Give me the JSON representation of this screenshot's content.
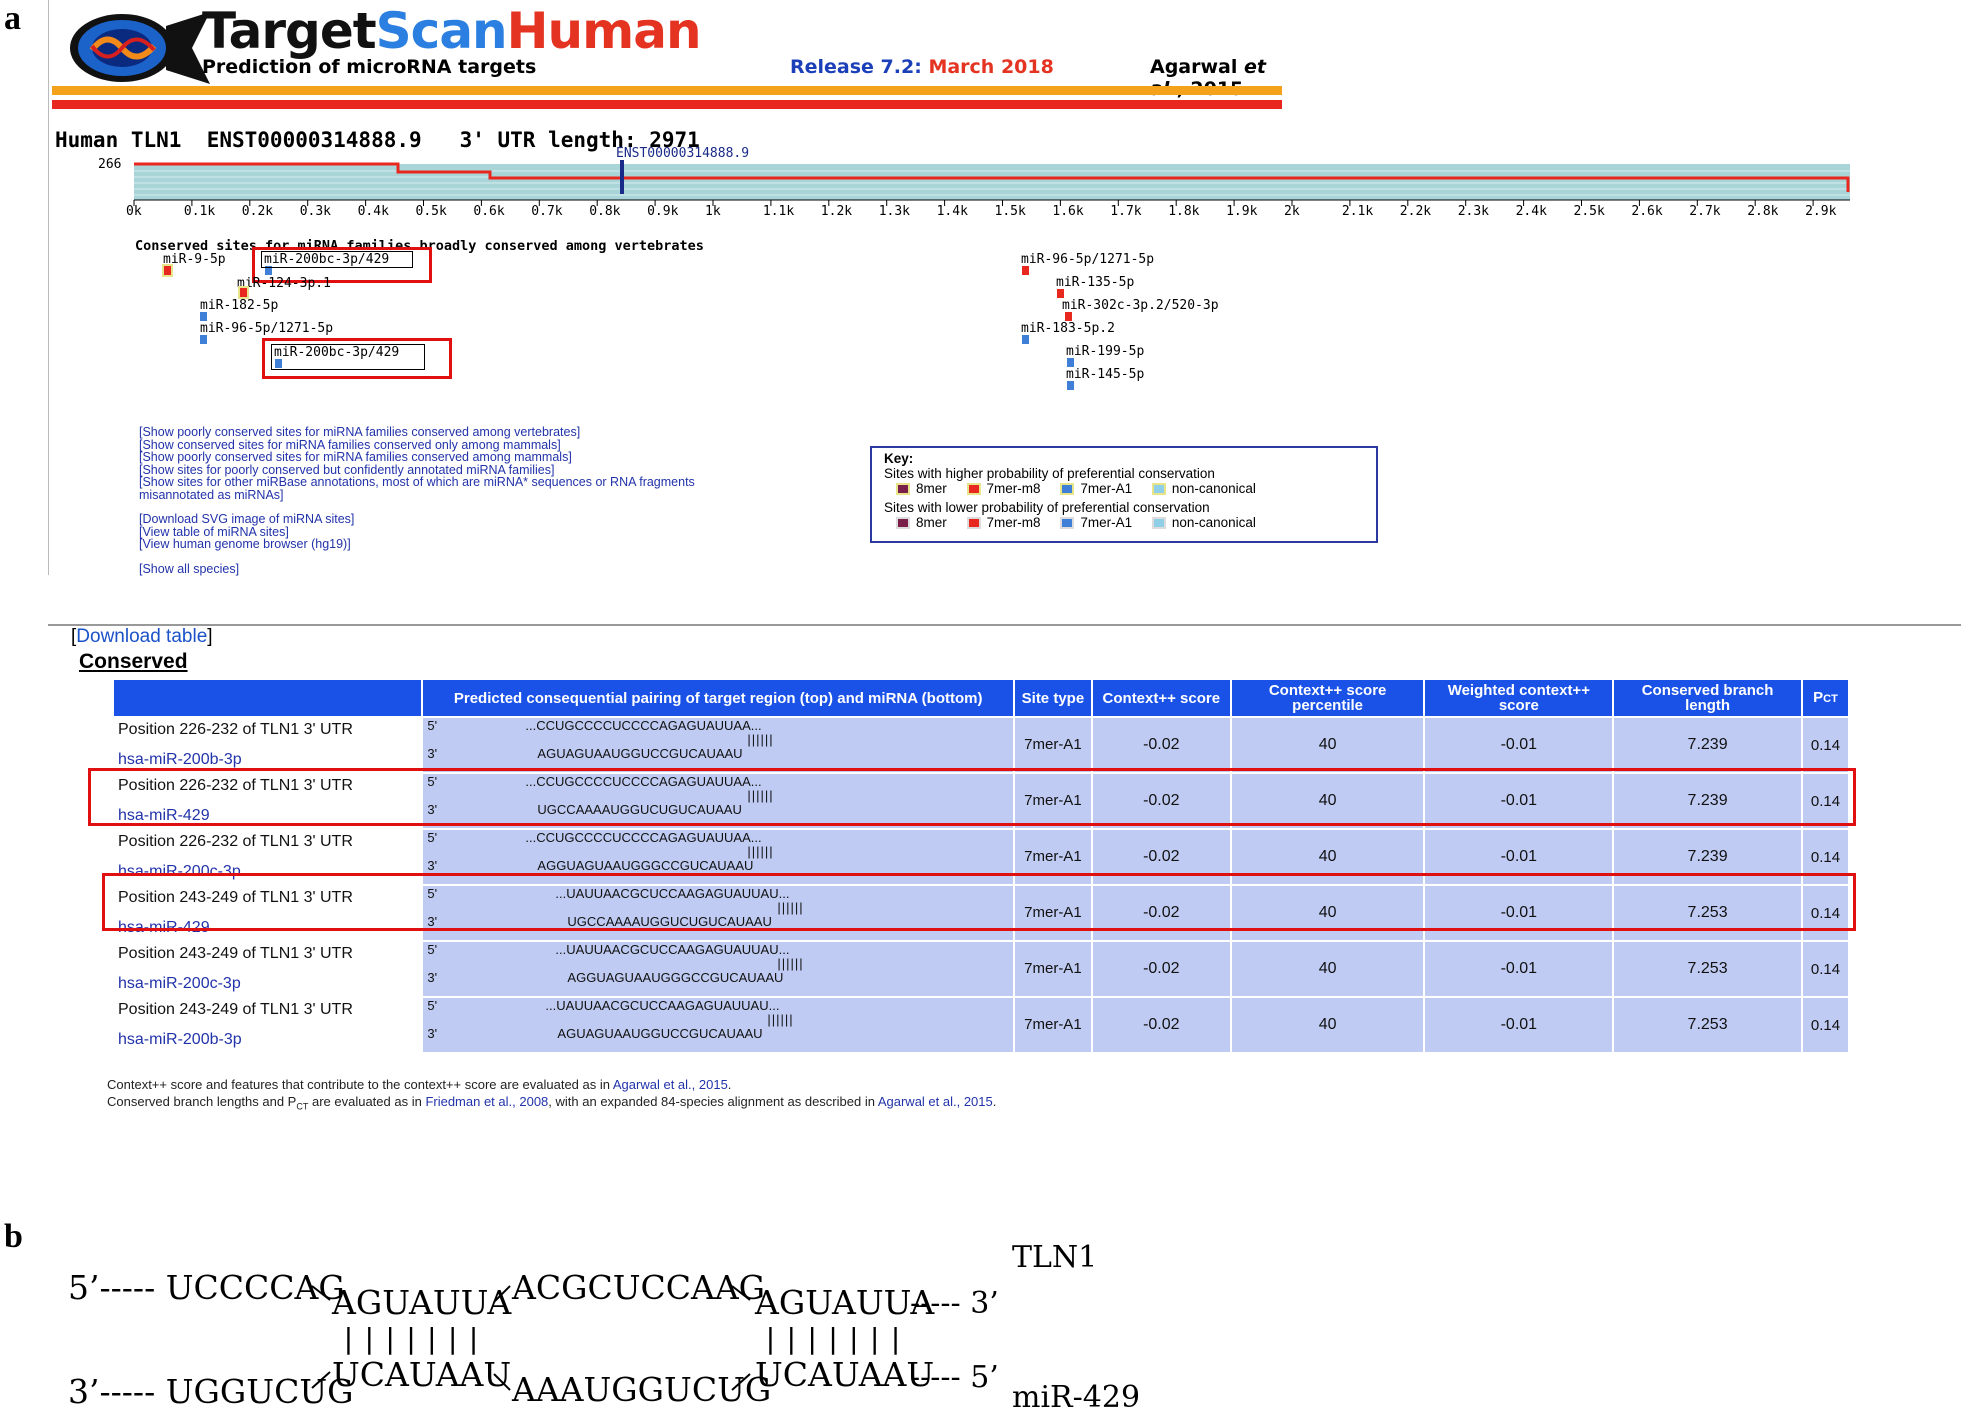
{
  "panel_a_label": "a",
  "panel_b_label": "b",
  "header": {
    "logo_target": "Target",
    "logo_scan": "Scan",
    "logo_human": "Human",
    "tagline": "Prediction of microRNA targets",
    "release_label": "Release 7.2:",
    "release_date": "March 2018",
    "citation_author": "Agarwal",
    "citation_etal": "et al.",
    "citation_year": ", 2015"
  },
  "gene_title": "Human TLN1  ENST00000314888.9   3' UTR length: 2971",
  "utr_track": {
    "y_label": "266",
    "marker_label": "ENST00000314888.9",
    "ticks": [
      "0k",
      "0.1k",
      "0.2k",
      "0.3k",
      "0.4k",
      "0.5k",
      "0.6k",
      "0.7k",
      "0.8k",
      "0.9k",
      "1k",
      "1.1k",
      "1.2k",
      "1.3k",
      "1.4k",
      "1.5k",
      "1.6k",
      "1.7k",
      "1.8k",
      "1.9k",
      "2k",
      "2.1k",
      "2.2k",
      "2.3k",
      "2.4k",
      "2.5k",
      "2.6k",
      "2.7k",
      "2.8k",
      "2.9k"
    ]
  },
  "conserved_heading": "Conserved sites for miRNA families broadly conserved among vertebrates",
  "sites": [
    "miR-9-5p",
    "miR-200bc-3p/429",
    "miR-124-3p.1",
    "miR-182-5p",
    "miR-96-5p/1271-5p",
    "miR-200bc-3p/429",
    "miR-96-5p/1271-5p",
    "miR-135-5p",
    "miR-302c-3p.2/520-3p",
    "miR-183-5p.2",
    "miR-199-5p",
    "miR-145-5p"
  ],
  "links": [
    "[Show poorly conserved sites for miRNA families conserved among vertebrates]",
    "[Show conserved sites for miRNA families conserved only among mammals]",
    "[Show poorly conserved sites for miRNA families conserved among mammals]",
    "[Show sites for poorly conserved but confidently annotated miRNA families]",
    "[Show sites for other miRBase annotations, most of which are miRNA* sequences or RNA fragments",
    "misannotated as miRNAs]",
    "[Download SVG image of miRNA sites]",
    "[View table of miRNA sites]",
    "[View human genome browser (hg19)]",
    "[Show all species]"
  ],
  "key": {
    "title": "Key:",
    "high_label": "Sites with higher probability of preferential conservation",
    "low_label": "Sites with lower probability of preferential conservation",
    "items": [
      "8mer",
      "7mer-m8",
      "7mer-A1",
      "non-canonical"
    ],
    "colors": [
      "#7a1f4a",
      "#e8281e",
      "#3f7fd8",
      "#8fd0e8"
    ]
  },
  "download_table": {
    "open": "[",
    "label": "Download table",
    "close": "]"
  },
  "table_heading": "Conserved",
  "table": {
    "headers": [
      "",
      "Predicted consequential pairing of target region (top) and miRNA (bottom)",
      "Site type",
      "Context++ score",
      "Context++ score percentile",
      "Weighted context++ score",
      "Conserved branch length",
      "PCT"
    ],
    "rows": [
      {
        "position": "Position 226-232 of TLN1 3' UTR",
        "mirna": "hsa-miR-200b-3p",
        "top": "...CCUGCCCCUCCCCAGAGUAUUAA...",
        "bars": "||||||",
        "bottom": "AGUAGUAAUGGUCCGUCAUAAU",
        "site_type": "7mer-A1",
        "context": "-0.02",
        "percentile": "40",
        "weighted": "-0.01",
        "branch": "7.239",
        "pct": "0.14"
      },
      {
        "position": "Position 226-232 of TLN1 3' UTR",
        "mirna": "hsa-miR-429",
        "top": "...CCUGCCCCUCCCCAGAGUAUUAA...",
        "bars": "||||||",
        "bottom": "UGCCAAAAUGGUCUGUCAUAAU",
        "site_type": "7mer-A1",
        "context": "-0.02",
        "percentile": "40",
        "weighted": "-0.01",
        "branch": "7.239",
        "pct": "0.14"
      },
      {
        "position": "Position 226-232 of TLN1 3' UTR",
        "mirna": "hsa-miR-200c-3p",
        "top": "...CCUGCCCCUCCCCAGAGUAUUAA...",
        "bars": "||||||",
        "bottom": "AGGUAGUAAUGGGCCGUCAUAAU",
        "site_type": "7mer-A1",
        "context": "-0.02",
        "percentile": "40",
        "weighted": "-0.01",
        "branch": "7.239",
        "pct": "0.14"
      },
      {
        "position": "Position 243-249 of TLN1 3' UTR",
        "mirna": "hsa-miR-429",
        "top": "...UAUUAACGCUCCAAGAGUAUUAU...",
        "bars": "||||||",
        "bottom": "UGCCAAAAUGGUCUGUCAUAAU",
        "site_type": "7mer-A1",
        "context": "-0.02",
        "percentile": "40",
        "weighted": "-0.01",
        "branch": "7.253",
        "pct": "0.14"
      },
      {
        "position": "Position 243-249 of TLN1 3' UTR",
        "mirna": "hsa-miR-200c-3p",
        "top": "...UAUUAACGCUCCAAGAGUAUUAU...",
        "bars": "||||||",
        "bottom": "AGGUAGUAAUGGGCCGUCAUAAU",
        "site_type": "7mer-A1",
        "context": "-0.02",
        "percentile": "40",
        "weighted": "-0.01",
        "branch": "7.253",
        "pct": "0.14"
      },
      {
        "position": "Position 243-249 of TLN1 3' UTR",
        "mirna": "hsa-miR-200b-3p",
        "top": "...UAUUAACGCUCCAAGAGUAUUAU...",
        "bars": "||||||",
        "bottom": "AGUAGUAAUGGUCCGUCAUAAU",
        "site_type": "7mer-A1",
        "context": "-0.02",
        "percentile": "40",
        "weighted": "-0.01",
        "branch": "7.253",
        "pct": "0.14"
      }
    ]
  },
  "footnotes": {
    "line1_a": "Context++ score and features that contribute to the context++ score are evaluated as in ",
    "line1_link": "Agarwal et al., 2015",
    "line1_b": ".",
    "line2_a": "Conserved branch lengths and P",
    "line2_sub": "CT",
    "line2_b": " are evaluated as in ",
    "line2_link1": "Friedman et al., 2008",
    "line2_c": ", with an expanded 84-species alignment as described in ",
    "line2_link2": "Agarwal et al., 2015",
    "line2_d": "."
  },
  "panel_b": {
    "top_prefix": "5’----- UCCCCAG",
    "top_seg1": "AGUAUUA",
    "top_mid": "ACGCUCCAAG",
    "top_seg2": "AGUAUUA",
    "top_suffix": "----- 3’",
    "bars": "|||||||",
    "bottom_prefix": "3’----- UGGUCUG",
    "bottom_seg1": "UCAUAAU",
    "bottom_mid": "AAAUGGUCUG",
    "bottom_seg2": "UCAUAAU",
    "bottom_suffix": "----- 5’",
    "label_target": "TLN1",
    "label_mirna": "miR-429"
  }
}
